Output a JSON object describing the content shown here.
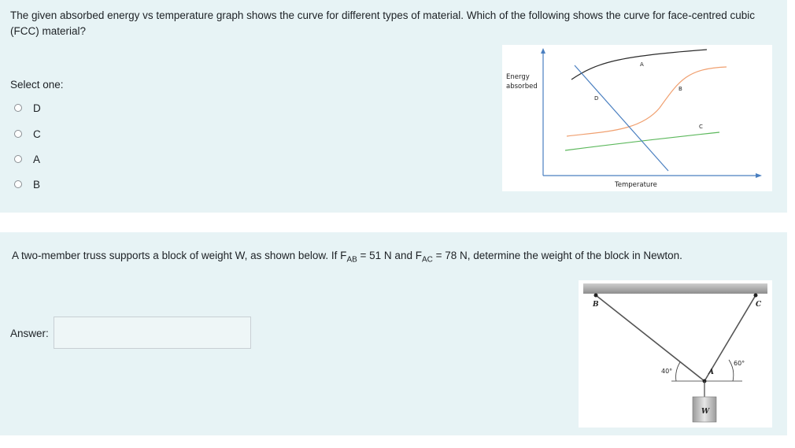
{
  "q1": {
    "question": "The given absorbed energy vs temperature graph shows the curve for different types of material. Which of the following shows the curve for face-centred cubic (FCC) material?",
    "select_label": "Select one:",
    "options": [
      "D",
      "C",
      "A",
      "B"
    ],
    "graph": {
      "ylabel_line1": "Energy",
      "ylabel_line2": "absorbed",
      "xlabel": "Temperature",
      "curve_labels": [
        "A",
        "B",
        "C",
        "D"
      ],
      "colors": {
        "A": "#2b2b2b",
        "B": "#f0a070",
        "C": "#5cb85c",
        "D": "#4a7fc0",
        "axis": "#4a7fc0"
      }
    }
  },
  "q2": {
    "question_pre": "A two-member truss supports a block of weight W, as shown below.  If F",
    "sub_ab": "AB",
    "mid": " = 51 N and F",
    "sub_ac": "AC",
    "question_post": " = 78 N, determine the weight of the block in Newton.",
    "answer_label": "Answer:",
    "answer_value": "",
    "figure": {
      "label_b": "B",
      "label_c": "C",
      "label_a": "A",
      "label_w": "W",
      "angle_left": "40°",
      "angle_right": "60°"
    }
  }
}
